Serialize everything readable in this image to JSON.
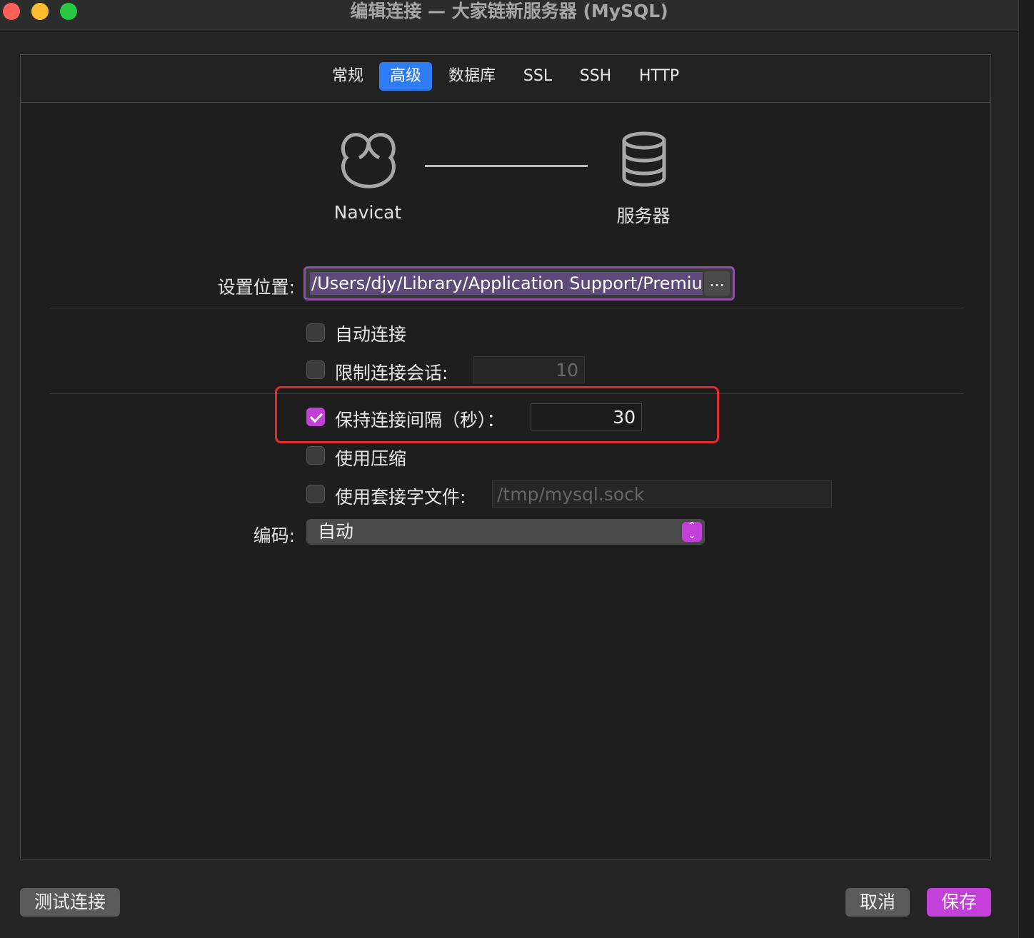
{
  "window": {
    "title": "编辑连接 — 大家链新服务器 (MySQL)"
  },
  "tabs": [
    {
      "label": "常规",
      "active": false
    },
    {
      "label": "高级",
      "active": true
    },
    {
      "label": "数据库",
      "active": false
    },
    {
      "label": "SSL",
      "active": false
    },
    {
      "label": "SSH",
      "active": false
    },
    {
      "label": "HTTP",
      "active": false
    }
  ],
  "diagram": {
    "client_label": "Navicat",
    "server_label": "服务器"
  },
  "settings": {
    "location_label": "设置位置:",
    "location_value": "/Users/djy/Library/Application Support/Premiu",
    "browse_label": "...",
    "auto_connect": {
      "label": "自动连接",
      "checked": false
    },
    "limit_sessions": {
      "label": "限制连接会话:",
      "checked": false,
      "value": "10"
    },
    "keepalive": {
      "label": "保持连接间隔（秒）：",
      "checked": true,
      "value": "30"
    },
    "compression": {
      "label": "使用压缩",
      "checked": false
    },
    "socket_file": {
      "label": "使用套接字文件:",
      "checked": false,
      "placeholder": "/tmp/mysql.sock"
    },
    "encoding_label": "编码:",
    "encoding_value": "自动"
  },
  "buttons": {
    "test": "测试连接",
    "cancel": "取消",
    "save": "保存"
  },
  "colors": {
    "accent": "#c23fd8",
    "tab_active": "#2d7cf6",
    "highlight": "#e32b2b"
  }
}
